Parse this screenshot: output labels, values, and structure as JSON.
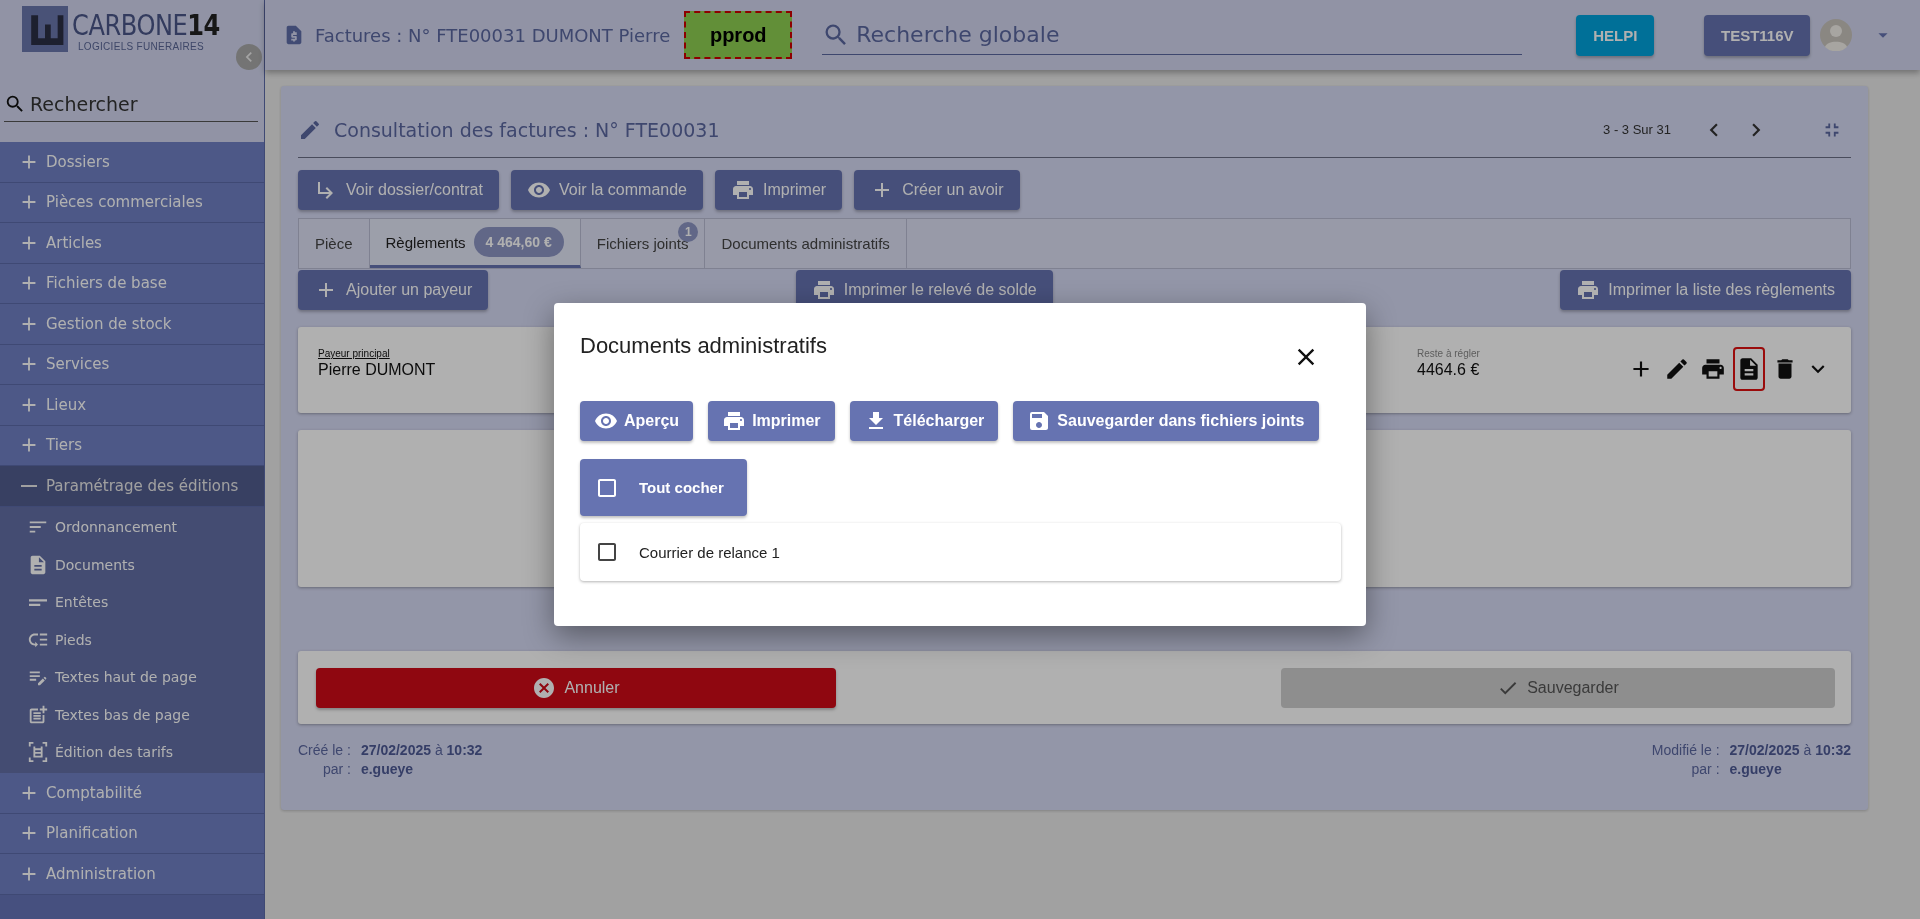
{
  "sidebar": {
    "logo": {
      "name": "CARBONE**14**",
      "tagline": "LOGICIELS FUNERAIRES"
    },
    "search": {
      "placeholder": "Rechercher"
    },
    "items": [
      {
        "label": "Dossiers",
        "expanded": false
      },
      {
        "label": "Pièces commerciales",
        "expanded": false
      },
      {
        "label": "Articles",
        "expanded": false
      },
      {
        "label": "Fichiers de base",
        "expanded": false
      },
      {
        "label": "Gestion de stock",
        "expanded": false
      },
      {
        "label": "Services",
        "expanded": false
      },
      {
        "label": "Lieux",
        "expanded": false
      },
      {
        "label": "Tiers",
        "expanded": false
      },
      {
        "label": "Paramétrage des éditions",
        "expanded": true,
        "children": [
          {
            "label": "Ordonnancement"
          },
          {
            "label": "Documents"
          },
          {
            "label": "Entêtes"
          },
          {
            "label": "Pieds"
          },
          {
            "label": "Textes haut de page"
          },
          {
            "label": "Textes bas de page"
          },
          {
            "label": "Édition des tarifs"
          }
        ]
      },
      {
        "label": "Comptabilité",
        "expanded": false
      },
      {
        "label": "Planification",
        "expanded": false
      },
      {
        "label": "Administration",
        "expanded": false
      }
    ]
  },
  "topbar": {
    "title": "Factures : N° FTE00031 DUMONT Pierre",
    "environment": "pprod",
    "search": {
      "placeholder": "Recherche globale"
    },
    "help_button": "HELPI",
    "user_button": "TEST116V"
  },
  "main": {
    "title": "Consultation des factures : N° FTE00031",
    "pagination": "3 - 3 Sur 31",
    "actions": [
      "Voir dossier/contrat",
      "Voir la commande",
      "Imprimer",
      "Créer un avoir"
    ],
    "tabs": [
      {
        "label": "Pièce",
        "selected": false
      },
      {
        "label": "Règlements",
        "selected": true,
        "amount": "4 464,60 €"
      },
      {
        "label": "Fichiers joints",
        "selected": false,
        "count": "1"
      },
      {
        "label": "Documents administratifs",
        "selected": false
      }
    ],
    "payment_buttons": [
      "Ajouter un payeur",
      "Imprimer le relevé de solde",
      "Imprimer la liste des règlements"
    ],
    "payer": {
      "label": "Payeur principal",
      "name": "Pierre DUMONT",
      "remaining_label": "Reste à régler",
      "remaining": "4464.6 €",
      "actions": [
        {
          "highlighted": false
        },
        {
          "highlighted": false
        },
        {
          "highlighted": false
        },
        {
          "highlighted": true
        },
        {
          "highlighted": false
        }
      ]
    },
    "cancel_button": "Annuler",
    "save_button": {
      "label": "Sauvegarder",
      "disabled": true
    },
    "created": {
      "label": "Créé le :",
      "value": "**27/02/2025** à **10:32**",
      "by_label": "par :",
      "by": "e.gueye"
    },
    "modified": {
      "label": "Modifié le :",
      "value": "**27/02/2025** à **10:32**",
      "by_label": "par :",
      "by": "e.gueye"
    }
  },
  "dialog": {
    "title": "Documents administratifs",
    "buttons": [
      "Aperçu",
      "Imprimer",
      "Télécharger",
      "Sauvegarder dans fichiers joints"
    ],
    "select_all": {
      "label": "Tout cocher",
      "checked": false
    },
    "documents": [
      {
        "label": "Courrier de relance 1",
        "checked": false
      }
    ]
  }
}
